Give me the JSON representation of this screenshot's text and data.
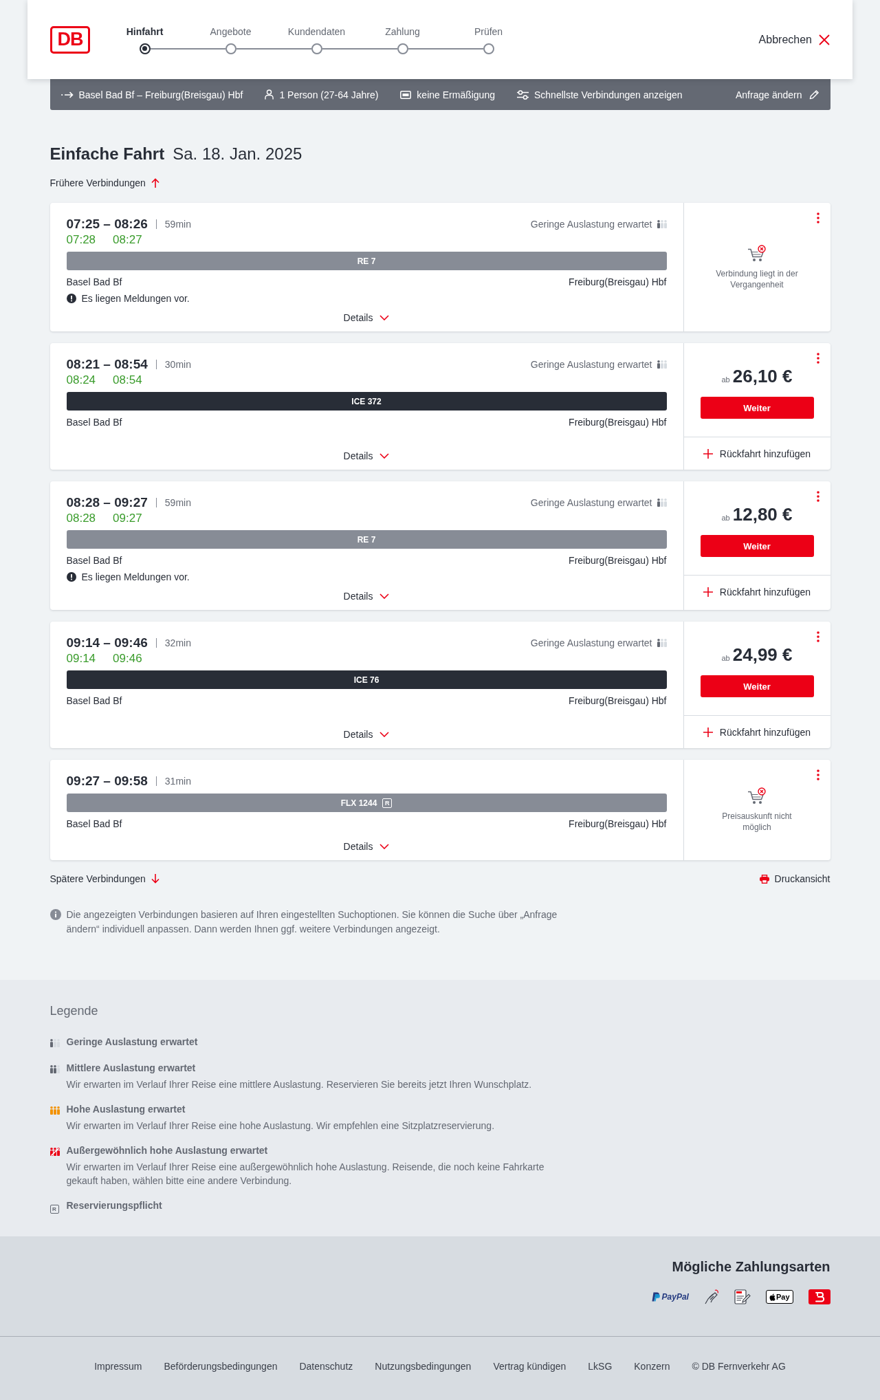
{
  "header": {
    "logo": "DB",
    "steps": [
      {
        "label": "Hinfahrt",
        "selected": true
      },
      {
        "label": "Angebote",
        "selected": false
      },
      {
        "label": "Kundendaten",
        "selected": false
      },
      {
        "label": "Zahlung",
        "selected": false
      },
      {
        "label": "Prüfen",
        "selected": false
      }
    ],
    "cancel_button": "Abbrechen"
  },
  "search_summary": {
    "route": "Basel Bad Bf – Freiburg(Breisgau) Hbf",
    "passengers": "1 Person (27-64 Jahre)",
    "discount": "keine Ermäßigung",
    "option": "Schnellste Verbindungen anzeigen",
    "edit_button": "Anfrage ändern"
  },
  "results": {
    "title": "Einfache Fahrt",
    "date": "Sa. 18. Jan. 2025",
    "earlier_link": "Frühere Verbindungen",
    "connections": [
      {
        "times": "07:25 – 08:26",
        "duration": "59min",
        "realtime": {
          "departure": "07:28",
          "arrival": "08:27"
        },
        "occupancy": {
          "kind": "low",
          "text": "Geringe Auslastung erwartet"
        },
        "train": {
          "label": "RE 7",
          "kind": "standard"
        },
        "from": "Basel Bad Bf",
        "to": "Freiburg(Breisgau) Hbf",
        "message": "Es liegen Meldungen vor.",
        "details": "Details",
        "offer": {
          "kind": "unavailable",
          "text": "Verbindung liegt in der Vergangenheit"
        }
      },
      {
        "times": "08:21 – 08:54",
        "duration": "30min",
        "realtime": {
          "departure": "08:24",
          "arrival": "08:54"
        },
        "occupancy": {
          "kind": "low",
          "text": "Geringe Auslastung erwartet"
        },
        "train": {
          "label": "ICE 372",
          "kind": "highspeed"
        },
        "from": "Basel Bad Bf",
        "to": "Freiburg(Breisgau) Hbf",
        "details": "Details",
        "offer": {
          "kind": "price",
          "prefix": "ab",
          "price": "26,10 €",
          "button": "Weiter",
          "return_link": "Rückfahrt hinzufügen"
        }
      },
      {
        "times": "08:28 – 09:27",
        "duration": "59min",
        "realtime": {
          "departure": "08:28",
          "arrival": "09:27"
        },
        "occupancy": {
          "kind": "low",
          "text": "Geringe Auslastung erwartet"
        },
        "train": {
          "label": "RE 7",
          "kind": "standard"
        },
        "from": "Basel Bad Bf",
        "to": "Freiburg(Breisgau) Hbf",
        "message": "Es liegen Meldungen vor.",
        "details": "Details",
        "offer": {
          "kind": "price",
          "prefix": "ab",
          "price": "12,80 €",
          "button": "Weiter",
          "return_link": "Rückfahrt hinzufügen"
        }
      },
      {
        "times": "09:14 – 09:46",
        "duration": "32min",
        "realtime": {
          "departure": "09:14",
          "arrival": "09:46"
        },
        "occupancy": {
          "kind": "low",
          "text": "Geringe Auslastung erwartet"
        },
        "train": {
          "label": "ICE 76",
          "kind": "highspeed"
        },
        "from": "Basel Bad Bf",
        "to": "Freiburg(Breisgau) Hbf",
        "details": "Details",
        "offer": {
          "kind": "price",
          "prefix": "ab",
          "price": "24,99 €",
          "button": "Weiter",
          "return_link": "Rückfahrt hinzufügen"
        }
      },
      {
        "times": "09:27 – 09:58",
        "duration": "31min",
        "train": {
          "label": "FLX 1244",
          "kind": "standard",
          "badge": "R"
        },
        "from": "Basel Bad Bf",
        "to": "Freiburg(Breisgau) Hbf",
        "details": "Details",
        "offer": {
          "kind": "unavailable",
          "text": "Preisauskunft nicht möglich"
        }
      }
    ],
    "later_link": "Spätere Verbindungen",
    "print_link": "Druckansicht",
    "info": "Die angezeigten Verbindungen basieren auf Ihren eingestellten Suchoptionen. Sie können die Suche über „Anfrage ändern“ individuell anpassen. Dann werden Ihnen ggf. weitere Verbindungen angezeigt."
  },
  "legend": {
    "title": "Legende",
    "items": [
      {
        "kind": "low",
        "title": "Geringe Auslastung erwartet"
      },
      {
        "kind": "medium",
        "title": "Mittlere Auslastung erwartet",
        "description": "Wir erwarten im Verlauf Ihrer Reise eine mittlere Auslastung. Reservieren Sie bereits jetzt Ihren Wunschplatz."
      },
      {
        "kind": "high",
        "title": "Hohe Auslastung erwartet",
        "description": "Wir erwarten im Verlauf Ihrer Reise eine hohe Auslastung. Wir empfehlen eine Sitzplatzreservierung."
      },
      {
        "kind": "very_high",
        "title": "Außergewöhnlich hohe Auslastung erwartet",
        "description": "Wir erwarten im Verlauf Ihrer Reise eine außergewöhnlich hohe Auslastung. Reisende, die noch keine Fahrkarte gekauft haben, wählen bitte eine andere Verbindung."
      },
      {
        "kind": "reservation",
        "symbol": "R",
        "title": "Reservierungspflicht"
      }
    ]
  },
  "payment": {
    "title": "Mögliche Zahlungsarten",
    "methods": [
      {
        "kind": "paypal",
        "label": "PayPal"
      },
      {
        "kind": "card"
      },
      {
        "kind": "sepa"
      },
      {
        "kind": "apple_pay",
        "label": "Pay"
      },
      {
        "kind": "tile"
      }
    ]
  },
  "footer": {
    "links": [
      "Impressum",
      "Beförderungsbedingungen",
      "Datenschutz",
      "Nutzungsbedingungen",
      "Vertrag kündigen",
      "LkSG",
      "Konzern",
      "© DB Fernverkehr AG"
    ]
  }
}
